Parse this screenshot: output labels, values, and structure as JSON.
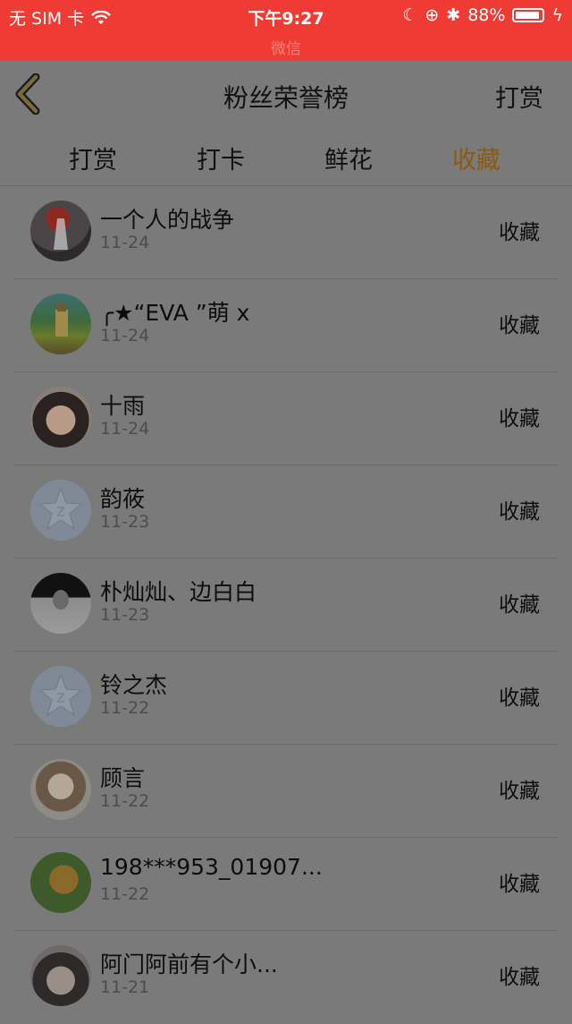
{
  "status": {
    "carrier": "无 SIM 卡",
    "time": "下午9:27",
    "battery": "88%",
    "battery_level": 0.88,
    "subtitle": "微信"
  },
  "nav": {
    "title": "粉丝荣誉榜",
    "right": "打赏"
  },
  "tabs": [
    {
      "label": "打赏"
    },
    {
      "label": "打卡"
    },
    {
      "label": "鲜花"
    },
    {
      "label": "收藏"
    }
  ],
  "active_tab": 3,
  "colors": {
    "status_bar": "#ef3b33",
    "active_tab": "#8a5a12"
  },
  "rows": [
    {
      "name": "一个人的战争",
      "date": "11-24",
      "action": "收藏",
      "avatar": "dark-figure"
    },
    {
      "name": "╭★“EVA ”萌 x",
      "date": "11-24",
      "action": "收藏",
      "avatar": "game-scene"
    },
    {
      "name": "十雨",
      "date": "11-24",
      "action": "收藏",
      "avatar": "child-photo"
    },
    {
      "name": "韵莜",
      "date": "11-23",
      "action": "收藏",
      "avatar": "default-qzone"
    },
    {
      "name": "朴灿灿、边白白",
      "date": "11-23",
      "action": "收藏",
      "avatar": "bw-photo"
    },
    {
      "name": "铃之杰",
      "date": "11-22",
      "action": "收藏",
      "avatar": "default-qzone"
    },
    {
      "name": "顾言",
      "date": "11-22",
      "action": "收藏",
      "avatar": "anime-girl"
    },
    {
      "name": "198***953_01907...",
      "date": "11-22",
      "action": "收藏",
      "avatar": "dog-photo"
    },
    {
      "name": "阿门阿前有个小...",
      "date": "11-21",
      "action": "收藏",
      "avatar": "boy-photo"
    }
  ]
}
